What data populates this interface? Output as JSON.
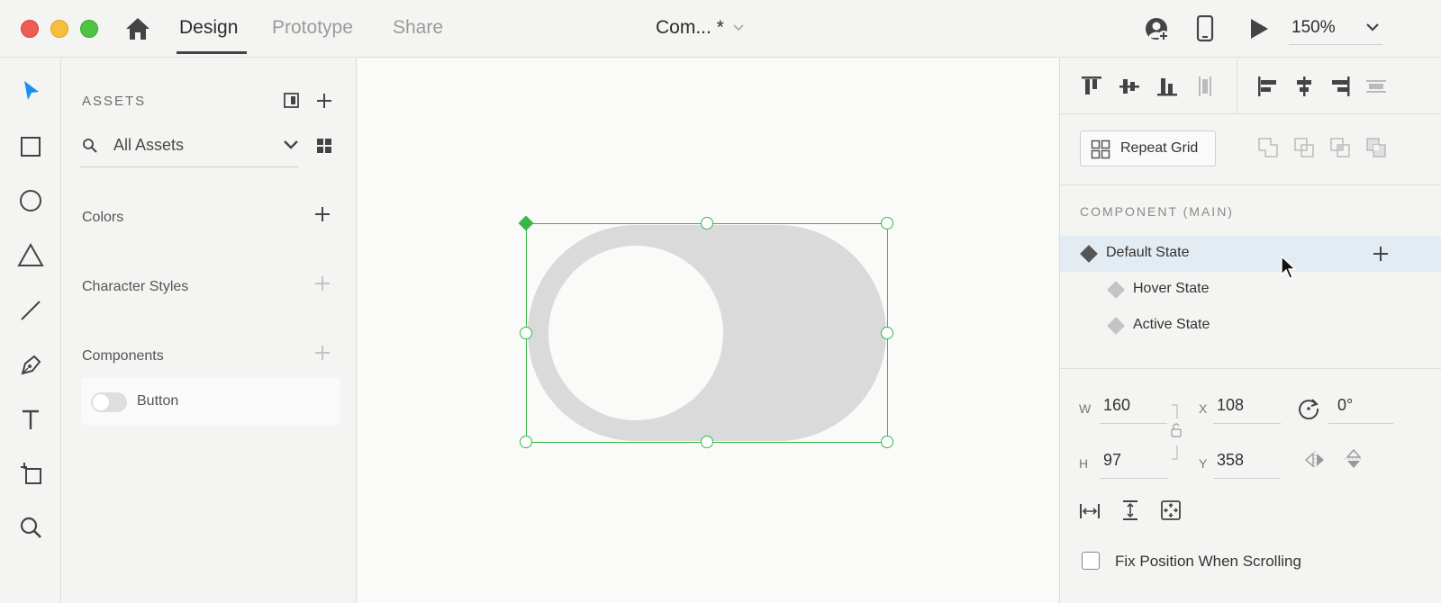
{
  "titlebar": {
    "tabs": [
      "Design",
      "Prototype",
      "Share"
    ],
    "active_tab": "Design",
    "document_title": "Com... *",
    "zoom": "150%"
  },
  "assets": {
    "title": "ASSETS",
    "search_value": "All Assets",
    "sections": {
      "colors": "Colors",
      "character_styles": "Character Styles",
      "components": "Components"
    },
    "component_items": [
      {
        "name": "Button"
      }
    ]
  },
  "inspector": {
    "repeat_grid_label": "Repeat Grid",
    "component_header": "COMPONENT (MAIN)",
    "states": [
      {
        "label": "Default State",
        "selected": true
      },
      {
        "label": "Hover State",
        "selected": false
      },
      {
        "label": "Active State",
        "selected": false
      }
    ],
    "transform": {
      "w_label": "W",
      "w_value": "160",
      "h_label": "H",
      "h_value": "97",
      "x_label": "X",
      "x_value": "108",
      "y_label": "Y",
      "y_value": "358",
      "rotation": "0°"
    },
    "fix_position_label": "Fix Position When Scrolling",
    "fix_position_checked": false
  },
  "colors": {
    "selection": "#35b84a",
    "selected_row": "#e4ecf3",
    "accent_tool": "#1a8ff0"
  }
}
